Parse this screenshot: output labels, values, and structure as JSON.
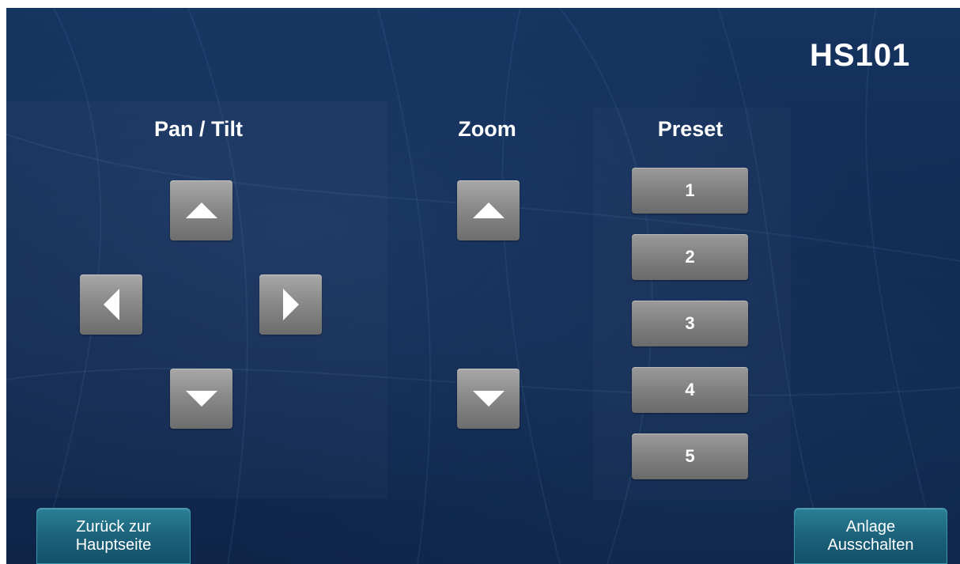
{
  "device_title": "HS101",
  "pan_tilt": {
    "label": "Pan / Tilt",
    "up_icon": "triangle-up-icon",
    "down_icon": "triangle-down-icon",
    "left_icon": "triangle-left-icon",
    "right_icon": "triangle-right-icon"
  },
  "zoom": {
    "label": "Zoom",
    "in_icon": "triangle-up-icon",
    "out_icon": "triangle-down-icon"
  },
  "preset": {
    "label": "Preset",
    "buttons": [
      "1",
      "2",
      "3",
      "4",
      "5"
    ]
  },
  "footer": {
    "back_line1": "Zurück zur",
    "back_line2": "Hauptseite",
    "off_line1": "Anlage",
    "off_line2": "Ausschalten"
  },
  "colors": {
    "background": "#112a52",
    "button_gray": "#8a8a8a",
    "nav_teal": "#1a6078",
    "text": "#ffffff"
  }
}
